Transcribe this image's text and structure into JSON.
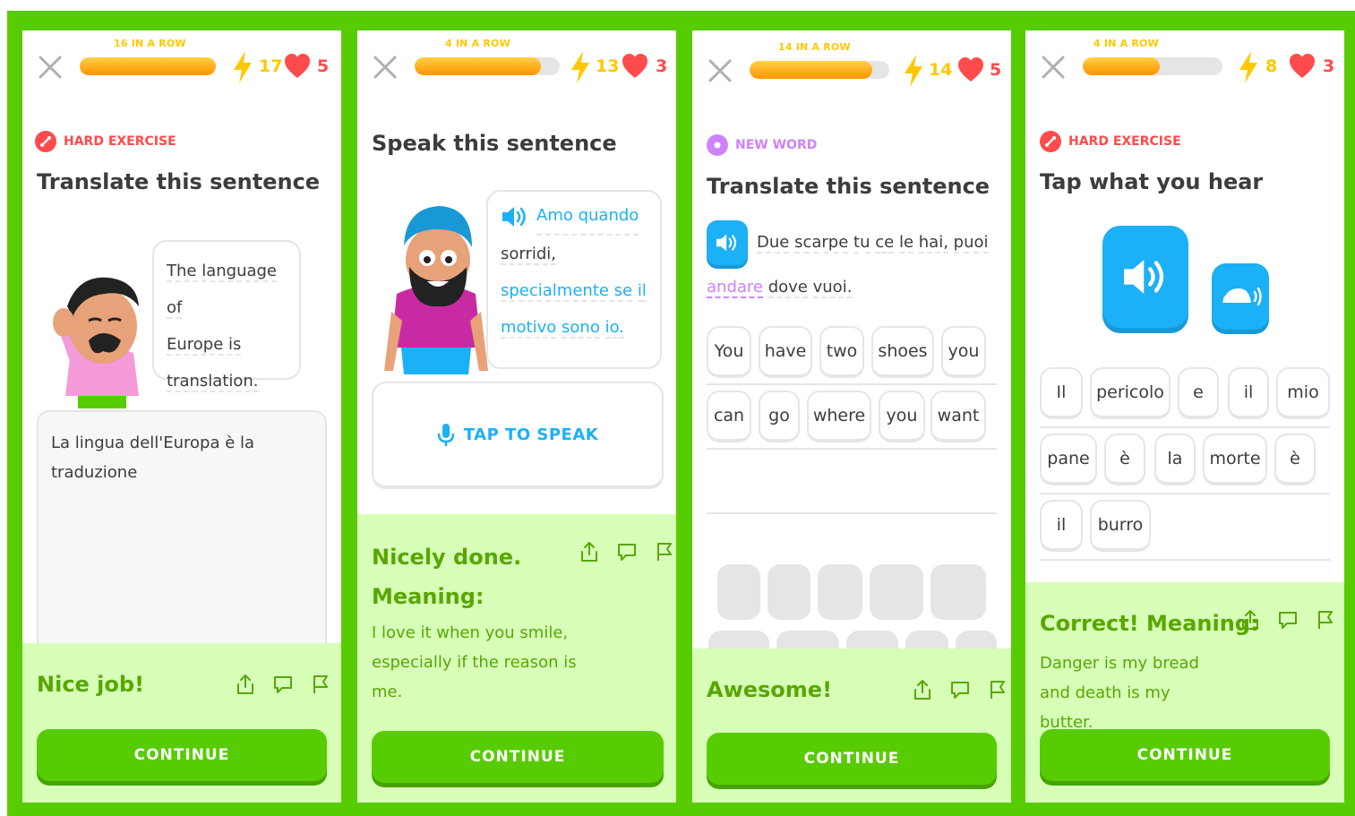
{
  "colors": {
    "frame": "#58cc02",
    "streak": "#ffc800",
    "heart": "#ff4b4b",
    "blue": "#1cb0f6",
    "purple": "#ce82ff",
    "footer": "#d7ffb8",
    "footer_text": "#58a700"
  },
  "icons": {
    "close": "close-icon",
    "bolt": "lightning-bolt-icon",
    "heart": "heart-icon",
    "share": "share-icon",
    "comment": "comment-icon",
    "flag": "flag-icon",
    "speaker": "speaker-icon",
    "mic": "microphone-icon",
    "turtle": "turtle-slow-audio-icon"
  },
  "panels": [
    {
      "streak": "16 IN A ROW",
      "progress": 1.0,
      "gems": "17",
      "hearts": "5",
      "badge": "HARD EXERCISE",
      "title": "Translate this sentence",
      "bubble": [
        "The language of",
        "Europe is",
        "translation."
      ],
      "answer": "La lingua dell'Europa è la traduzione",
      "feedback": "Nice job!",
      "button": "CONTINUE"
    },
    {
      "streak": "4 IN A ROW",
      "progress": 0.87,
      "gems": "13",
      "hearts": "3",
      "title": "Speak this sentence",
      "bubble": [
        "Amo quando",
        "sorridi,",
        "specialmente se",
        "il",
        "motivo",
        "sono",
        "io."
      ],
      "speak_label": "TAP TO SPEAK",
      "feedback": "Nicely done.",
      "meaning_label": "Meaning:",
      "meaning": "I love it when you smile, especially if the reason is me.",
      "button": "CONTINUE"
    },
    {
      "streak": "14 IN A ROW",
      "progress": 0.88,
      "gems": "14",
      "hearts": "5",
      "badge": "NEW WORD",
      "title": "Translate this sentence",
      "sentence": [
        "Due",
        "scarpe",
        "tu",
        "ce",
        "le",
        "hai,",
        "puoi",
        "andare",
        "dove",
        "vuoi."
      ],
      "new_word": "andare",
      "answer_row1": [
        "You",
        "have",
        "two",
        "shoes",
        "you"
      ],
      "answer_row2": [
        "can",
        "go",
        "where",
        "you",
        "want"
      ],
      "feedback": "Awesome!",
      "button": "CONTINUE"
    },
    {
      "streak": "4 IN A ROW",
      "progress": 0.55,
      "gems": "8",
      "hearts": "3",
      "badge": "HARD EXERCISE",
      "title": "Tap what you hear",
      "row1": [
        "Il",
        "pericolo",
        "e",
        "il",
        "mio"
      ],
      "row2": [
        "pane",
        "è",
        "la",
        "morte",
        "è"
      ],
      "row3": [
        "il",
        "burro"
      ],
      "feedback": "Correct! Meaning:",
      "meaning": "Danger is my bread and death is my butter.",
      "button": "CONTINUE"
    }
  ]
}
